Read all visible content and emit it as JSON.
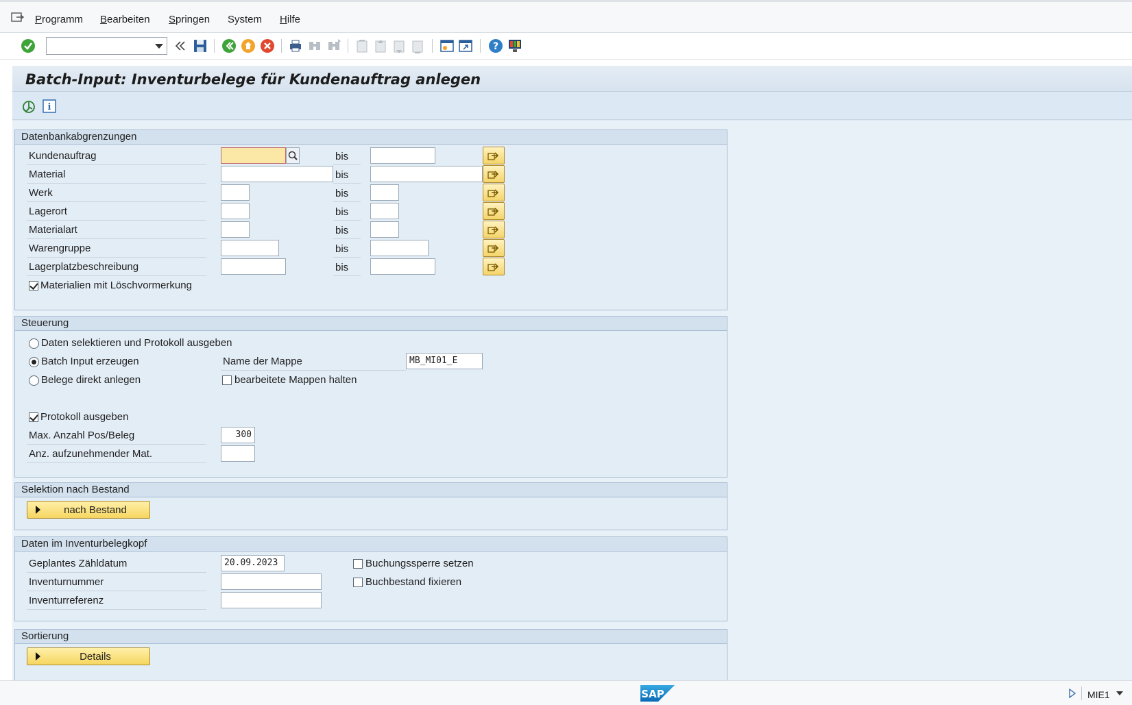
{
  "menu": {
    "items": [
      {
        "label": "Programm",
        "mnemonic": "P",
        "rest": "rogramm"
      },
      {
        "label": "Bearbeiten",
        "mnemonic": "B",
        "rest": "earbeiten"
      },
      {
        "label": "Springen",
        "mnemonic": "S",
        "rest": "pringen"
      },
      {
        "label": "System",
        "mnemonic": "",
        "rest": "System"
      },
      {
        "label": "Hilfe",
        "mnemonic": "H",
        "rest": "ilfe"
      }
    ]
  },
  "toolbar": {
    "command_value": "",
    "icons": [
      "enter-icon",
      "back-nav-icon",
      "save-icon",
      "back-icon",
      "exit-icon",
      "cancel-icon",
      "print-icon",
      "find-icon",
      "find-next-icon",
      "first-page-icon",
      "prev-page-icon",
      "next-page-icon",
      "last-page-icon",
      "new-session-icon",
      "shortcut-icon",
      "help-icon",
      "layout-icon"
    ]
  },
  "title": "Batch-Input: Inventurbelege für Kundenauftrag anlegen",
  "app_toolbar": {
    "icons": [
      "execute-icon",
      "info-icon"
    ]
  },
  "groups": {
    "db": {
      "title": "Datenbankabgrenzungen",
      "bis": "bis",
      "rows": [
        {
          "label": "Kundenauftrag",
          "from": "",
          "to": ""
        },
        {
          "label": "Material",
          "from": "",
          "to": ""
        },
        {
          "label": "Werk",
          "from": "",
          "to": ""
        },
        {
          "label": "Lagerort",
          "from": "",
          "to": ""
        },
        {
          "label": "Materialart",
          "from": "",
          "to": ""
        },
        {
          "label": "Warengruppe",
          "from": "",
          "to": ""
        },
        {
          "label": "Lagerplatzbeschreibung",
          "from": "",
          "to": ""
        }
      ],
      "checkbox_label": "Materialien mit Löschvormerkung",
      "checkbox_checked": true
    },
    "steuerung": {
      "title": "Steuerung",
      "radio1": "Daten selektieren und Protokoll ausgeben",
      "radio2": "Batch Input erzeugen",
      "radio3": "Belege direkt anlegen",
      "selected": 2,
      "mappe_label": "Name der Mappe",
      "mappe_value": "MB_MI01_E",
      "halten_label": "bearbeitete Mappen halten",
      "protokoll_label": "Protokoll ausgeben",
      "max_label": "Max. Anzahl Pos/Beleg",
      "max_value": "300",
      "anz_label": "Anz. aufzunehmender Mat.",
      "anz_value": ""
    },
    "bestand": {
      "title": "Selektion nach Bestand",
      "button": "nach Bestand"
    },
    "kopf": {
      "title": "Daten im Inventurbelegkopf",
      "datum_label": "Geplantes Zähldatum",
      "datum_value": "20.09.2023",
      "inventurnummer_label": "Inventurnummer",
      "inventurnummer_value": "",
      "inventurreferenz_label": "Inventurreferenz",
      "inventurreferenz_value": "",
      "sperre_label": "Buchungssperre setzen",
      "fixieren_label": "Buchbestand fixieren"
    },
    "sortierung": {
      "title": "Sortierung",
      "button": "Details"
    }
  },
  "status": {
    "logo": "SAP",
    "tcode": "MIE1"
  }
}
